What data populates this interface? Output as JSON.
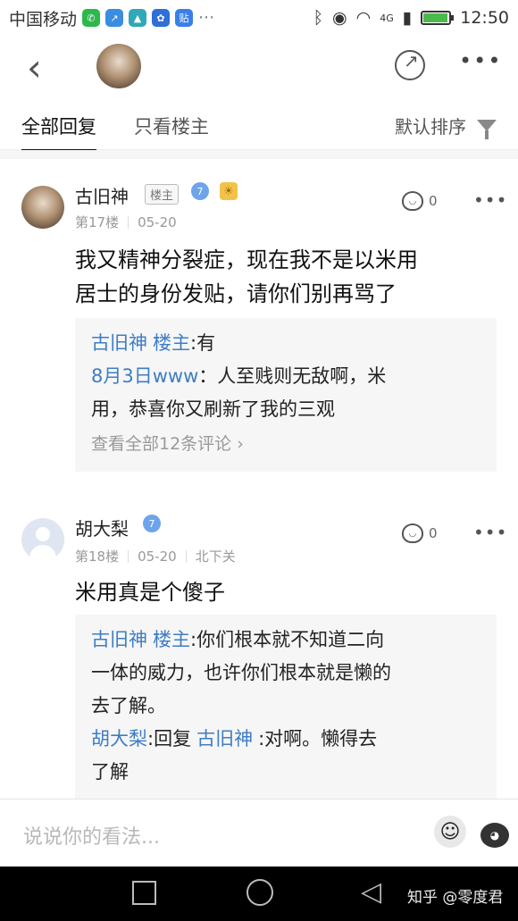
{
  "status_bar": {
    "carrier": "中国移动",
    "network": "4G",
    "time": "12:50",
    "battery_level": 0.95
  },
  "header": {
    "back_icon": "chevron-left-icon",
    "share_icon": "share-icon",
    "more_icon": "more-icon"
  },
  "tabs": {
    "all_replies": "全部回复",
    "only_op": "只看楼主",
    "sort_label": "默认排序"
  },
  "comments": [
    {
      "name": "古旧神",
      "op_badge": "楼主",
      "verify_level": "7",
      "floor": "第17楼",
      "date": "05-20",
      "location": "",
      "likes": "0",
      "text_line1": "我又精神分裂症，现在我不是以米用",
      "text_line2": "居士的身份发贴，请你们别再骂了",
      "replies": [
        {
          "name": "古旧神",
          "lz": "楼主",
          "sep": ":",
          "text": "有"
        },
        {
          "name": "8月3日www",
          "sep": "：",
          "text": "人至贱则无敌啊，米",
          "text2": "用，恭喜你又刷新了我的三观"
        }
      ],
      "view_all": "查看全部12条评论 ›"
    },
    {
      "name": "胡大梨",
      "verify_level": "7",
      "floor": "第18楼",
      "date": "05-20",
      "location": "北下关",
      "likes": "0",
      "text_line1": "米用真是个傻子",
      "replies": [
        {
          "name": "古旧神",
          "lz": "楼主",
          "sep": ":",
          "text": "你们根本就不知道二向",
          "text2": "一体的威力，也许你们根本就是懒的",
          "text3": "去了解。"
        },
        {
          "name": "胡大梨",
          "sep": ":",
          "pre": "回复",
          "target": "古旧神",
          "text": ":对啊。懒得去",
          "text2": "了解"
        }
      ]
    }
  ],
  "input_bar": {
    "placeholder": "说说你的看法..."
  },
  "watermark": "知乎 @零度君"
}
